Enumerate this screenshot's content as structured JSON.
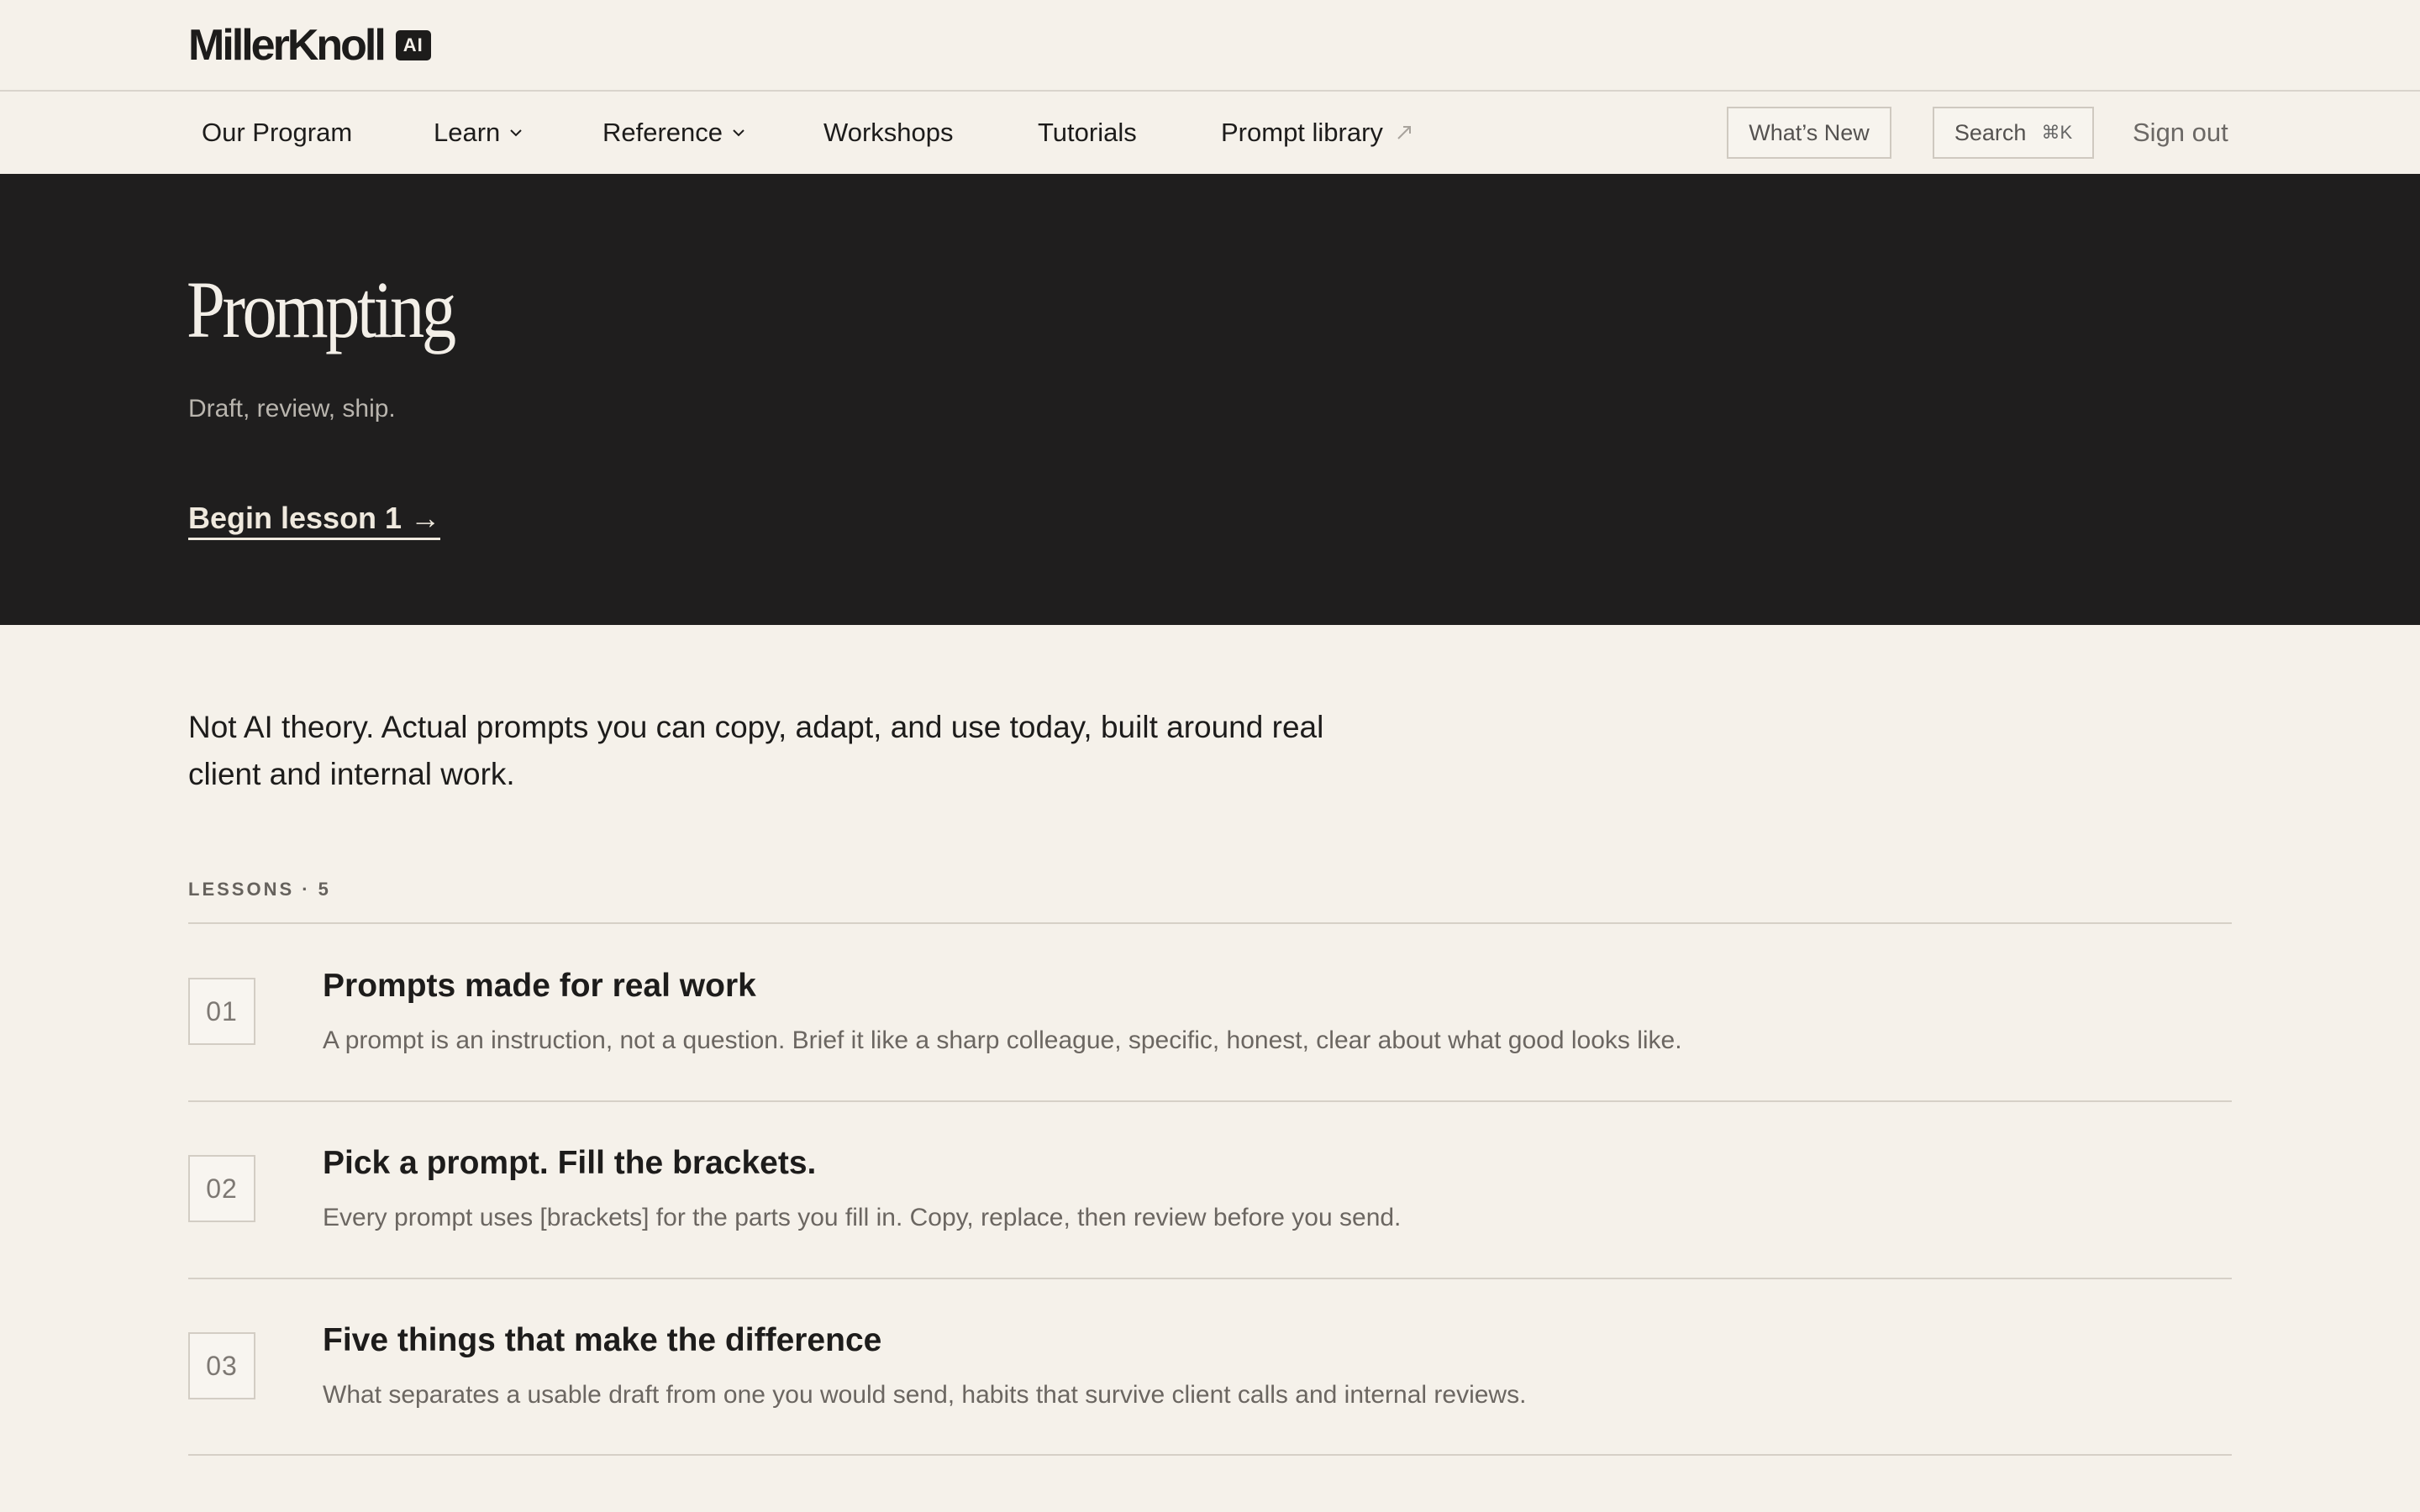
{
  "brand": {
    "name": "MillerKnoll",
    "badge": "AI"
  },
  "nav": {
    "items": [
      {
        "label": "Our Program"
      },
      {
        "label": "Learn"
      },
      {
        "label": "Reference"
      },
      {
        "label": "Workshops"
      },
      {
        "label": "Tutorials"
      },
      {
        "label": "Prompt library"
      }
    ],
    "whats_new": "What’s New",
    "search": {
      "label": "Search",
      "shortcut": "⌘K"
    },
    "sign_out": "Sign out"
  },
  "hero": {
    "title": "Prompting",
    "subtitle": "Draft, review, ship.",
    "cta": "Begin lesson 1 →"
  },
  "intro": "Not AI theory. Actual prompts you can copy, adapt, and use today, built around real client and internal work.",
  "lessons": {
    "label": "LESSONS · 5",
    "items": [
      {
        "number": "01",
        "title": "Prompts made for real work",
        "description": "A prompt is an instruction, not a question. Brief it like a sharp colleague, specific, honest, clear about what good looks like."
      },
      {
        "number": "02",
        "title": "Pick a prompt. Fill the brackets.",
        "description": "Every prompt uses [brackets] for the parts you fill in. Copy, replace, then review before you send."
      },
      {
        "number": "03",
        "title": "Five things that make the difference",
        "description": "What separates a usable draft from one you would send, habits that survive client calls and internal reviews."
      }
    ]
  }
}
